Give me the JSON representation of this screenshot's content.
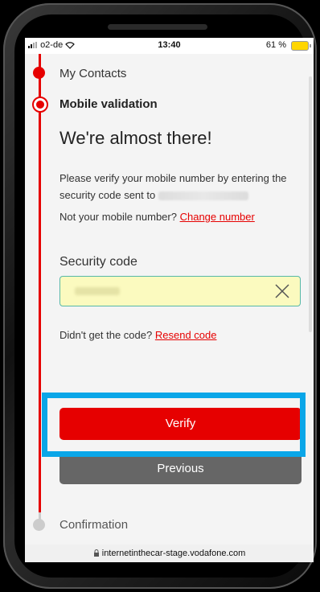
{
  "status_bar": {
    "carrier": "o2-de",
    "time": "13:40",
    "battery": "61 %"
  },
  "steps": {
    "contacts": "My Contacts",
    "mobile_validation": "Mobile validation",
    "confirmation": "Confirmation"
  },
  "content": {
    "heading": "We're almost there!",
    "verify_text": "Please verify your mobile number by entering the security code sent to",
    "not_your_number": "Not your mobile number?",
    "change_number": "Change number",
    "security_code_label": "Security code",
    "didnt_get_code": "Didn't get the code?",
    "resend_code": "Resend code"
  },
  "buttons": {
    "verify": "Verify",
    "previous": "Previous"
  },
  "browser": {
    "url": "internetinthecar-stage.vodafone.com"
  },
  "colors": {
    "accent": "#e60000",
    "highlight": "#0aa6e8",
    "input_bg": "#fbfabf"
  }
}
